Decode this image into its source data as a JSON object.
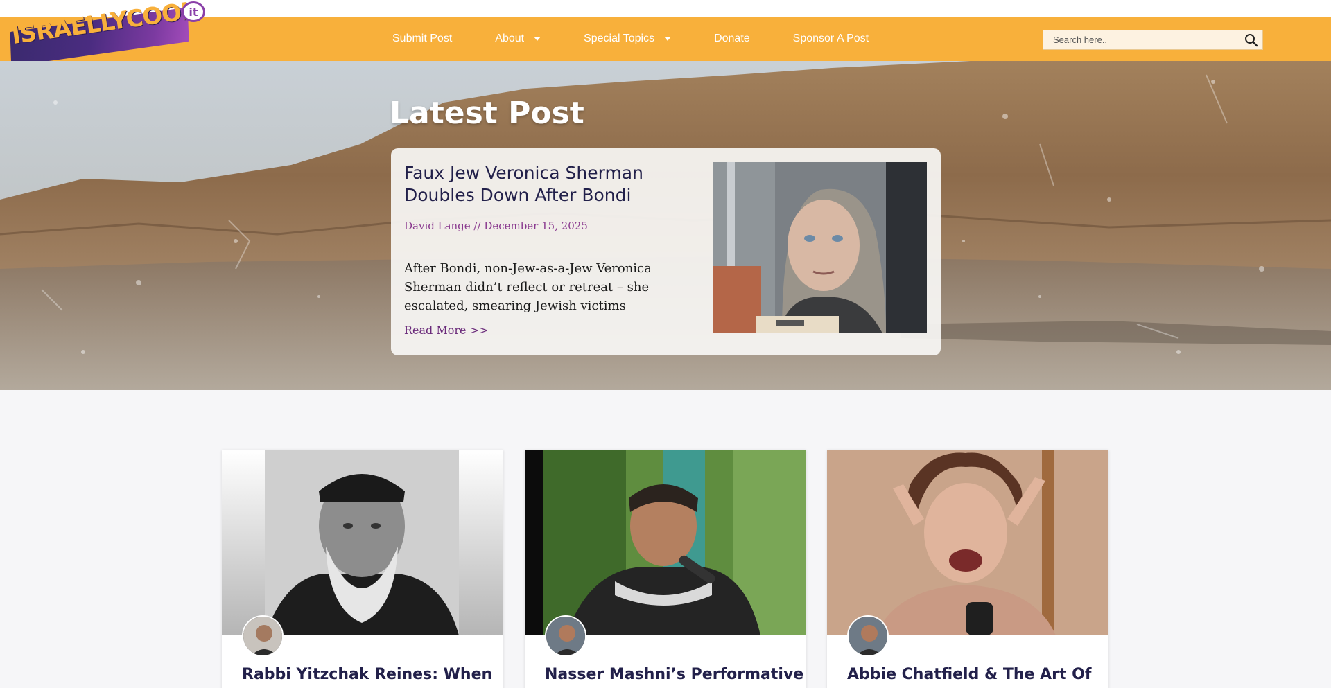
{
  "site": {
    "logo_text": "ISRAELLYCOOL",
    "logo_badge": "it"
  },
  "nav": {
    "items": [
      {
        "label": "Submit Post",
        "has_dropdown": false
      },
      {
        "label": "About",
        "has_dropdown": true
      },
      {
        "label": "Special Topics",
        "has_dropdown": true
      },
      {
        "label": "Donate",
        "has_dropdown": false
      },
      {
        "label": "Sponsor A Post",
        "has_dropdown": false
      }
    ],
    "search_placeholder": "Search here.."
  },
  "hero": {
    "heading": "Latest Post",
    "post": {
      "title": "Faux Jew Veronica Sherman Doubles Down After Bondi",
      "meta": "David Lange // December 15, 2025",
      "excerpt": "After Bondi, non-Jew-as-a-Jew Veronica Sherman didn’t reflect or retreat – she escalated, smearing Jewish victims",
      "read_more": "Read More >>"
    }
  },
  "cards": [
    {
      "title": "Rabbi Yitzchak Reines: When"
    },
    {
      "title": "Nasser Mashni’s Performative"
    },
    {
      "title": "Abbie Chatfield & The Art Of"
    }
  ],
  "colors": {
    "nav_bg": "#f8b03b",
    "brand_purple": "#8a3a8f",
    "title_navy": "#22204a"
  }
}
